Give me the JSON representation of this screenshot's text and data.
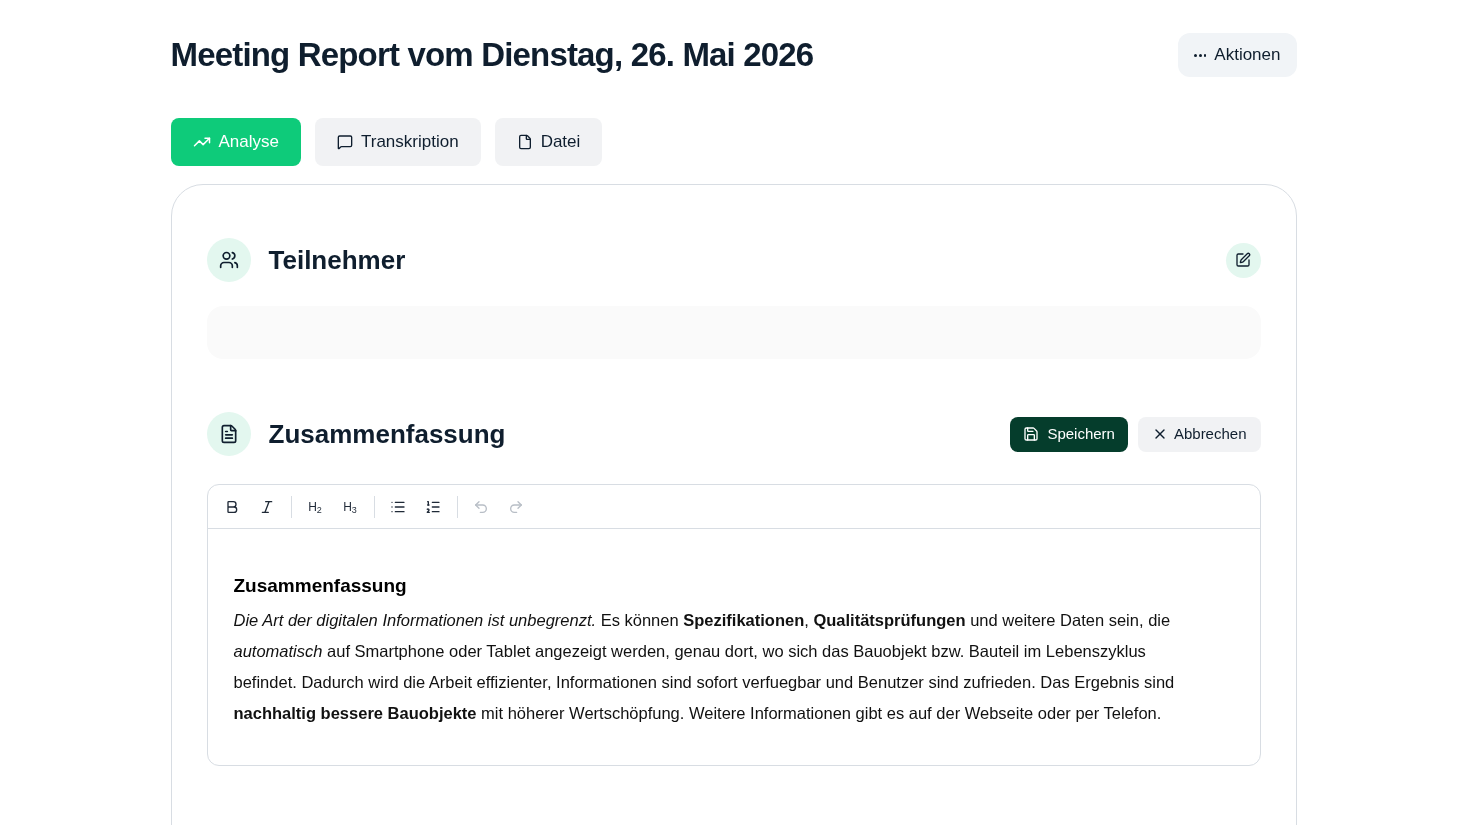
{
  "title": "Meeting Report vom Dienstag, 26. Mai 2026",
  "actions_button": {
    "label": "Aktionen"
  },
  "tabs": [
    {
      "label": "Analyse",
      "kind": "trend",
      "selected": true
    },
    {
      "label": "Transkription",
      "kind": "chat",
      "selected": false
    },
    {
      "label": "Datei",
      "kind": "file",
      "selected": false
    }
  ],
  "participants": {
    "title": "Teilnehmer"
  },
  "summary": {
    "title": "Zusammenfassung",
    "save_button": "Speichern",
    "cancel_button": "Abbrechen",
    "toolbar": [
      [
        {
          "kind": "bold",
          "disabled": false
        },
        {
          "kind": "italic",
          "disabled": false
        }
      ],
      [
        {
          "kind": "heading",
          "label": "H$_{2}$",
          "disabled": false
        },
        {
          "kind": "heading",
          "label": "H$_{3}$",
          "disabled": false
        }
      ],
      [
        {
          "kind": "bullet-list",
          "disabled": false
        },
        {
          "kind": "ordered-list",
          "disabled": false
        }
      ],
      [
        {
          "kind": "undo",
          "disabled": true
        },
        {
          "kind": "redo",
          "disabled": true
        }
      ]
    ],
    "editor": {
      "heading": "Zusammenfassung",
      "paragraph": "*Die Art der digitalen Informationen ist unbegrenzt.* Es können **Spezifikationen**, **Qualitätsprüfungen** und weitere Daten sein, die *automatisch* auf Smartphone oder Tablet angezeigt werden, genau dort, wo sich das Bauobjekt bzw. Bauteil im Lebenszyklus befindet. Dadurch wird die Arbeit effizienter, Informationen sind sofort verfuegbar und Benutzer sind zufrieden. Das Ergebnis sind **nachhaltig bessere Bauobjekte** mit höherer Wertschöpfung. Weitere Informationen gibt es auf der Webseite oder per Telefon."
    }
  }
}
